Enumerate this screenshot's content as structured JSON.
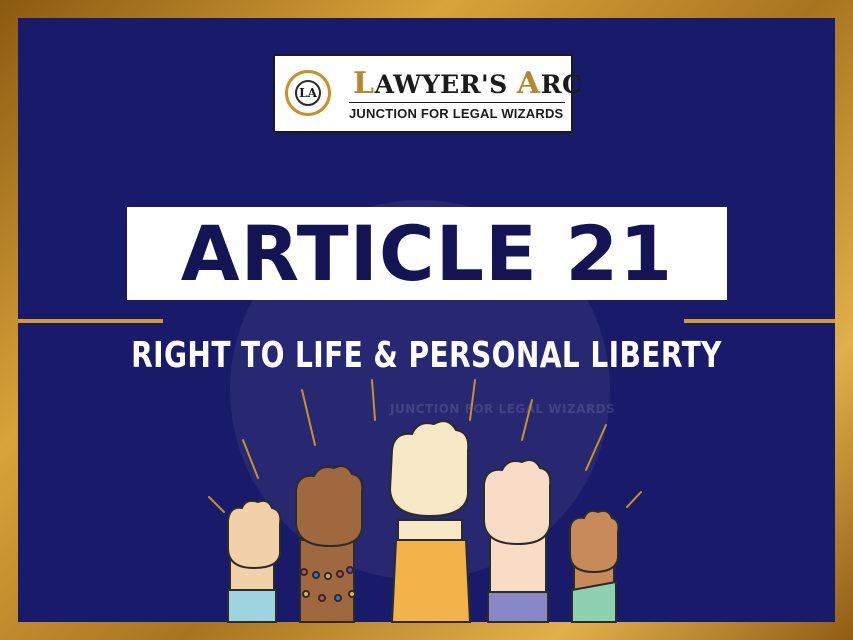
{
  "logo": {
    "emblem_text": "LA",
    "name_first": "L",
    "name_mid": "AWYER'S ",
    "name_second": "A",
    "name_last": "RC",
    "tagline": "JUNCTION FOR LEGAL WIZARDS"
  },
  "watermark": {
    "text": "JUNCTION FOR LEGAL WIZARDS"
  },
  "title": "ARTICLE 21",
  "subtitle": "RIGHT TO LIFE & PERSONAL LIBERTY",
  "colors": {
    "panel": "#1a1a6a",
    "gold": "#d49a34",
    "title_text": "#141454",
    "white": "#ffffff"
  },
  "illustration": {
    "name": "raised-fists",
    "count": 5
  }
}
